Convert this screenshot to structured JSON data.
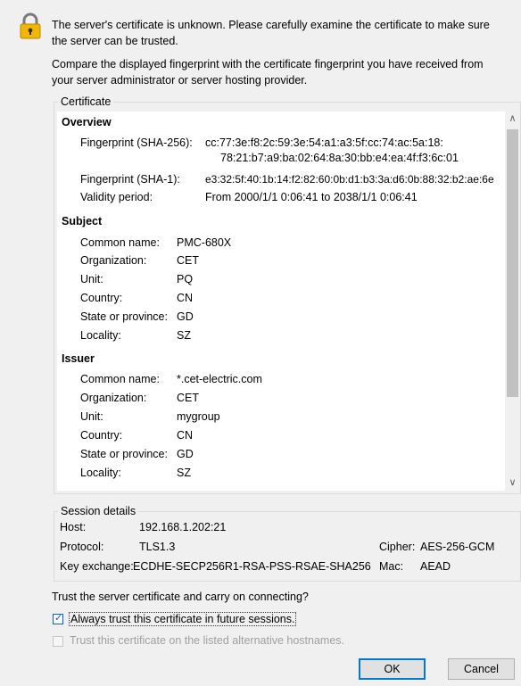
{
  "header": {
    "line1": "The server's certificate is unknown. Please carefully examine the certificate to make sure",
    "line2": "the server can be trusted.",
    "compare1": "Compare the displayed fingerprint with the certificate fingerprint you have received from",
    "compare2": "your server administrator or server hosting provider."
  },
  "certificate": {
    "title": "Certificate",
    "overview": {
      "heading": "Overview",
      "fp256_label": "Fingerprint (SHA-256):",
      "fp256_line1": "cc:77:3e:f8:2c:59:3e:54:a1:a3:5f:cc:74:ac:5a:18:",
      "fp256_line2": "78:21:b7:a9:ba:02:64:8a:30:bb:e4:ea:4f:f3:6c:01",
      "fp1_label": "Fingerprint (SHA-1):",
      "fp1_value": "e3:32:5f:40:1b:14:f2:82:60:0b:d1:b3:3a:d6:0b:88:32:b2:ae:6e",
      "validity_label": "Validity period:",
      "validity_value": "From 2000/1/1 0:06:41 to 2038/1/1 0:06:41"
    },
    "subject": {
      "heading": "Subject",
      "cn_label": "Common name:",
      "cn": "PMC-680X",
      "org_label": "Organization:",
      "org": "CET",
      "unit_label": "Unit:",
      "unit": "PQ",
      "country_label": "Country:",
      "country": "CN",
      "state_label": "State or province:",
      "state": "GD",
      "locality_label": "Locality:",
      "locality": "SZ"
    },
    "issuer": {
      "heading": "Issuer",
      "cn_label": "Common name:",
      "cn": "*.cet-electric.com",
      "org_label": "Organization:",
      "org": "CET",
      "unit_label": "Unit:",
      "unit": "mygroup",
      "country_label": "Country:",
      "country": "CN",
      "state_label": "State or province:",
      "state": "GD",
      "locality_label": "Locality:",
      "locality": "SZ"
    }
  },
  "session": {
    "title": "Session details",
    "host_label": "Host:",
    "host": "192.168.1.202:21",
    "protocol_label": "Protocol:",
    "protocol": "TLS1.3",
    "cipher_label": "Cipher:",
    "cipher": "AES-256-GCM",
    "kex_label": "Key exchange:",
    "kex": "ECDHE-SECP256R1-RSA-PSS-RSAE-SHA256",
    "mac_label": "Mac:",
    "mac": "AEAD"
  },
  "trust": {
    "question": "Trust the server certificate and carry on connecting?",
    "always_label": "Always trust this certificate in future sessions.",
    "always_checked": true,
    "alt_label": "Trust this certificate on the listed alternative hostnames.",
    "alt_enabled": false
  },
  "buttons": {
    "ok": "OK",
    "cancel": "Cancel"
  }
}
